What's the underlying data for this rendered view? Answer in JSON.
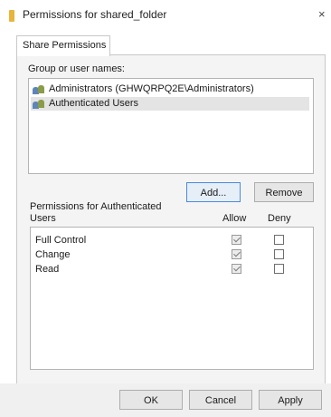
{
  "window": {
    "title": "Permissions for shared_folder",
    "close_glyph": "×"
  },
  "tab": {
    "label": "Share Permissions"
  },
  "group": {
    "label": "Group or user names:",
    "users": [
      {
        "name": "Administrators (GHWQRPQ2E\\Administrators)",
        "selected": false
      },
      {
        "name": "Authenticated Users",
        "selected": true
      }
    ],
    "add_label": "Add...",
    "remove_label": "Remove"
  },
  "permissions": {
    "label_line1": "Permissions for Authenticated",
    "label_line2": "Users",
    "allow_header": "Allow",
    "deny_header": "Deny",
    "rows": [
      {
        "name": "Full Control",
        "allow": true,
        "deny": false
      },
      {
        "name": "Change",
        "allow": true,
        "deny": false
      },
      {
        "name": "Read",
        "allow": true,
        "deny": false
      }
    ]
  },
  "buttons": {
    "ok": "OK",
    "cancel": "Cancel",
    "apply": "Apply"
  },
  "icons": {
    "folder": "folder-icon",
    "user_group": "user-group-icon",
    "close": "close-icon"
  }
}
